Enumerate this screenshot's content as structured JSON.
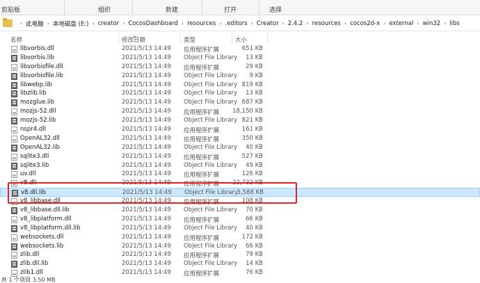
{
  "ribbon": {
    "groups": [
      "剪贴板",
      "组织",
      "新建",
      "打开",
      "选择"
    ]
  },
  "address": {
    "crumbs": [
      "此电脑",
      "本地磁盘 (E:)",
      "creator",
      "CocosDashboard",
      "resources",
      ".editors",
      "Creator",
      "2.4.2",
      "resources",
      "cocos2d-x",
      "external",
      "win32",
      "libs"
    ]
  },
  "columns": {
    "name": "名称",
    "date": "修改日期",
    "type": "类型",
    "size": "大小"
  },
  "files": [
    {
      "name": "libvorbis.dll",
      "date": "2021/5/13 14:49",
      "type": "应用程序扩展",
      "size": "651 KB",
      "icon": "dll-file-icon"
    },
    {
      "name": "libvorbis.lib",
      "date": "2021/5/13 14:49",
      "type": "Object File Library",
      "size": "13 KB",
      "icon": "lib-file-icon"
    },
    {
      "name": "libvorbisfile.dll",
      "date": "2021/5/13 14:49",
      "type": "应用程序扩展",
      "size": "29 KB",
      "icon": "dll-file-icon"
    },
    {
      "name": "libvorbisfile.lib",
      "date": "2021/5/13 14:49",
      "type": "Object File Library",
      "size": "9 KB",
      "icon": "lib-file-icon"
    },
    {
      "name": "libwebp.lib",
      "date": "2021/5/13 14:49",
      "type": "Object File Library",
      "size": "819 KB",
      "icon": "lib-file-icon"
    },
    {
      "name": "libzlib.lib",
      "date": "2021/5/13 14:49",
      "type": "Object File Library",
      "size": "13 KB",
      "icon": "lib-file-icon"
    },
    {
      "name": "mozglue.lib",
      "date": "2021/5/13 14:49",
      "type": "Object File Library",
      "size": "687 KB",
      "icon": "lib-file-icon"
    },
    {
      "name": "mozjs-52.dll",
      "date": "2021/5/13 14:49",
      "type": "应用程序扩展",
      "size": "18,150 KB",
      "icon": "dll-file-icon"
    },
    {
      "name": "mozjs-52.lib",
      "date": "2021/5/13 14:49",
      "type": "Object File Library",
      "size": "821 KB",
      "icon": "lib-file-icon"
    },
    {
      "name": "nspr4.dll",
      "date": "2021/5/13 14:49",
      "type": "应用程序扩展",
      "size": "161 KB",
      "icon": "dll-file-icon"
    },
    {
      "name": "OpenAL32.dll",
      "date": "2021/5/13 14:49",
      "type": "应用程序扩展",
      "size": "350 KB",
      "icon": "dll-file-icon"
    },
    {
      "name": "OpenAL32.lib",
      "date": "2021/5/13 14:49",
      "type": "Object File Library",
      "size": "40 KB",
      "icon": "lib-file-icon"
    },
    {
      "name": "sqlite3.dll",
      "date": "2021/5/13 14:49",
      "type": "应用程序扩展",
      "size": "527 KB",
      "icon": "dll-file-icon"
    },
    {
      "name": "sqlite3.lib",
      "date": "2021/5/13 14:49",
      "type": "Object File Library",
      "size": "49 KB",
      "icon": "lib-file-icon"
    },
    {
      "name": "uv.dll",
      "date": "2021/5/13 14:49",
      "type": "应用程序扩展",
      "size": "126 KB",
      "icon": "dll-file-icon"
    },
    {
      "name": "v8.dll",
      "date": "2021/5/13 14:49",
      "type": "应用程序扩展",
      "size": "22,732 KB",
      "icon": "dll-file-icon"
    },
    {
      "name": "v8.dll.lib",
      "date": "2021/5/13 14:49",
      "type": "Object File Library",
      "size": "3,588 KB",
      "icon": "lib-file-icon",
      "selected": true
    },
    {
      "name": "v8_libbase.dll",
      "date": "2021/5/13 14:49",
      "type": "应用程序扩展",
      "size": "108 KB",
      "icon": "dll-file-icon"
    },
    {
      "name": "v8_libbase.dll.lib",
      "date": "2021/5/13 14:49",
      "type": "Object File Library",
      "size": "70 KB",
      "icon": "lib-file-icon"
    },
    {
      "name": "v8_libplatform.dll",
      "date": "2021/5/13 14:49",
      "type": "应用程序扩展",
      "size": "66 KB",
      "icon": "dll-file-icon"
    },
    {
      "name": "v8_libplatform.dll.lib",
      "date": "2021/5/13 14:49",
      "type": "Object File Library",
      "size": "40 KB",
      "icon": "lib-file-icon"
    },
    {
      "name": "websockets.dll",
      "date": "2021/5/13 14:49",
      "type": "应用程序扩展",
      "size": "172 KB",
      "icon": "dll-file-icon"
    },
    {
      "name": "websockets.lib",
      "date": "2021/5/13 14:49",
      "type": "Object File Library",
      "size": "66 KB",
      "icon": "lib-file-icon"
    },
    {
      "name": "zlib.dll",
      "date": "2021/5/13 14:49",
      "type": "应用程序扩展",
      "size": "79 KB",
      "icon": "dll-file-icon"
    },
    {
      "name": "zlib.dll.lib",
      "date": "2021/5/13 14:49",
      "type": "Object File Library",
      "size": "14 KB",
      "icon": "lib-file-icon"
    },
    {
      "name": "zlib1.dll",
      "date": "2021/5/13 14:49",
      "type": "应用程序扩展",
      "size": "76 KB",
      "icon": "dll-file-icon"
    }
  ],
  "status": {
    "text": "共 1 个项目  3.50 MB"
  },
  "colors": {
    "selection": "#cce8ff",
    "selection_border": "#99d1ff",
    "annotation": "#e0232a"
  }
}
